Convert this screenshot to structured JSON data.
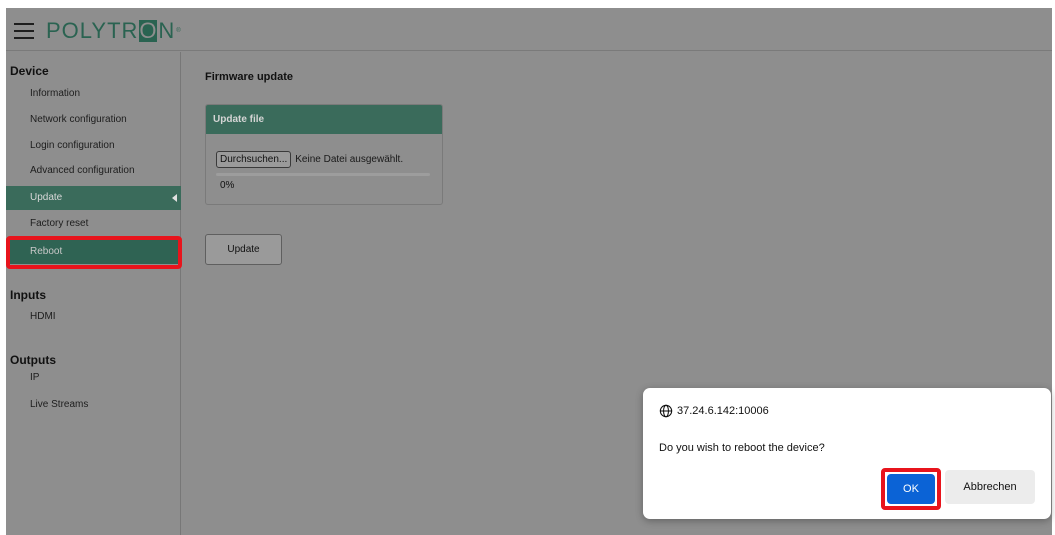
{
  "header": {
    "menu_icon": "hamburger-icon",
    "logo_text_left": "POLYTR",
    "logo_o": "O",
    "logo_text_right": "N",
    "logo_reg": "®"
  },
  "sidebar": {
    "sections": [
      {
        "title": "Device"
      },
      {
        "title": "Inputs"
      },
      {
        "title": "Outputs"
      }
    ],
    "device_items": [
      {
        "label": "Information"
      },
      {
        "label": "Network configuration"
      },
      {
        "label": "Login configuration"
      },
      {
        "label": "Advanced configuration"
      },
      {
        "label": "Update"
      },
      {
        "label": "Factory reset"
      },
      {
        "label": "Reboot"
      }
    ],
    "input_items": [
      {
        "label": "HDMI"
      }
    ],
    "output_items": [
      {
        "label": "IP"
      },
      {
        "label": "Live Streams"
      }
    ],
    "active_item": "Update"
  },
  "main": {
    "title": "Firmware update",
    "panel": {
      "header": "Update file",
      "browse_label": "Durchsuchen...",
      "file_status": "Keine Datei ausgewählt.",
      "progress": 0,
      "progress_text": "0%"
    },
    "update_button": "Update"
  },
  "dialog": {
    "origin": "37.24.6.142:10006",
    "origin_icon": "globe-icon",
    "message": "Do you wish to reboot the device?",
    "ok_label": "OK",
    "cancel_label": "Abbrechen"
  },
  "colors": {
    "accent": "#3a6b5b",
    "background": "#8e8e8e",
    "ok_blue": "#0b63d6",
    "highlight": "#e8141c"
  }
}
